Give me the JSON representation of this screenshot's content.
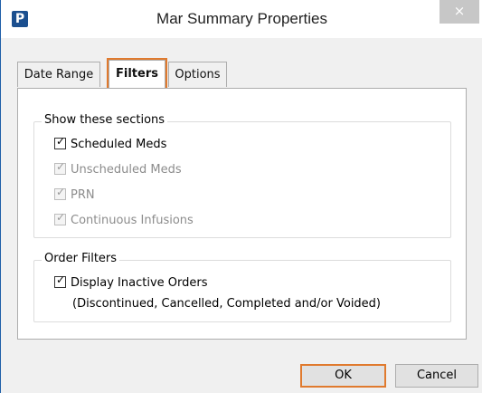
{
  "window": {
    "title": "Mar Summary Properties",
    "app_icon_letter": "P",
    "close_glyph": "×"
  },
  "tabs": [
    {
      "label": "Date Range",
      "active": false
    },
    {
      "label": "Filters",
      "active": true
    },
    {
      "label": "Options",
      "active": false
    }
  ],
  "show_sections": {
    "title": "Show these sections",
    "items": [
      {
        "label": "Scheduled Meds",
        "checked": true,
        "enabled": true
      },
      {
        "label": "Unscheduled Meds",
        "checked": true,
        "enabled": false
      },
      {
        "label": "PRN",
        "checked": true,
        "enabled": false
      },
      {
        "label": "Continuous Infusions",
        "checked": true,
        "enabled": false
      }
    ]
  },
  "order_filters": {
    "title": "Order Filters",
    "item": {
      "label": "Display Inactive Orders",
      "checked": true,
      "enabled": true
    },
    "note": "(Discontinued, Cancelled, Completed and/or Voided)"
  },
  "buttons": {
    "ok": "OK",
    "cancel": "Cancel"
  },
  "icons": {
    "app": "app-logo-icon",
    "close": "close-icon",
    "check": "checkmark-icon"
  },
  "colors": {
    "highlight": "#e07a2e",
    "window_border": "#1f5fa8"
  }
}
